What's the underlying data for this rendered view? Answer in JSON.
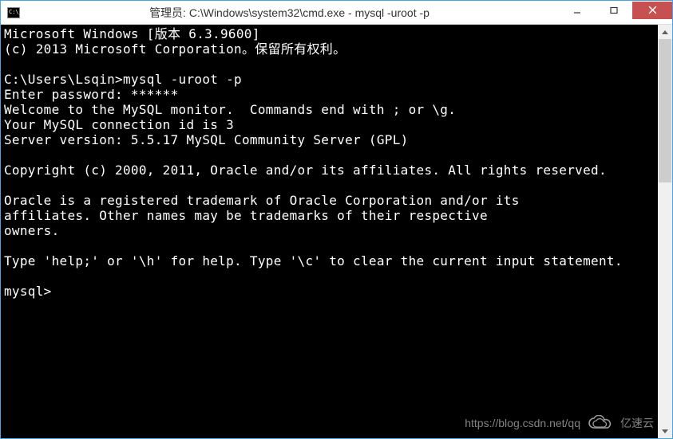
{
  "window": {
    "title": "管理员: C:\\Windows\\system32\\cmd.exe - mysql  -uroot -p"
  },
  "terminal": {
    "lines": [
      "Microsoft Windows [版本 6.3.9600]",
      "(c) 2013 Microsoft Corporation。保留所有权利。",
      "",
      "C:\\Users\\Lsqin>mysql -uroot -p",
      "Enter password: ******",
      "Welcome to the MySQL monitor.  Commands end with ; or \\g.",
      "Your MySQL connection id is 3",
      "Server version: 5.5.17 MySQL Community Server (GPL)",
      "",
      "Copyright (c) 2000, 2011, Oracle and/or its affiliates. All rights reserved.",
      "",
      "Oracle is a registered trademark of Oracle Corporation and/or its",
      "affiliates. Other names may be trademarks of their respective",
      "owners.",
      "",
      "Type 'help;' or '\\h' for help. Type '\\c' to clear the current input statement.",
      "",
      "mysql>"
    ]
  },
  "watermark": {
    "url": "https://blog.csdn.net/qq",
    "brand": "亿速云"
  }
}
